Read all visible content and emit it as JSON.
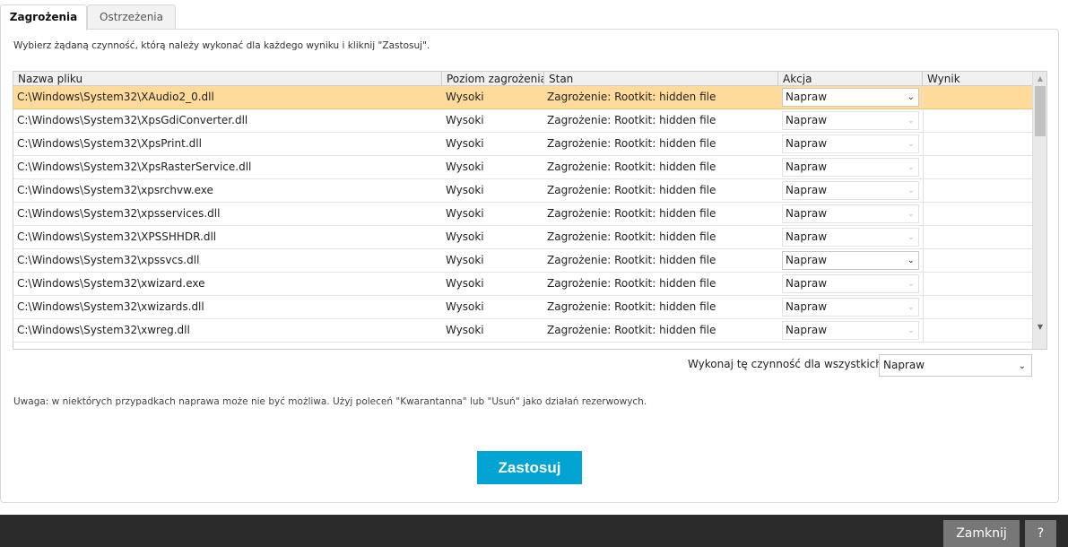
{
  "tabs": [
    {
      "label": "Zagrożenia",
      "active": true
    },
    {
      "label": "Ostrzeżenia",
      "active": false
    }
  ],
  "instruction": "Wybierz żądaną czynność, którą należy wykonać dla każdego wyniku i kliknij \"Zastosuj\".",
  "table": {
    "columns": [
      "Nazwa pliku",
      "Poziom zagrożenia",
      "Stan",
      "Akcja",
      "Wynik"
    ],
    "rows": [
      {
        "file": "C:\\Windows\\System32\\XAudio2_0.dll",
        "level": "Wysoki",
        "state": "Zagrożenie: Rootkit: hidden file",
        "action": "Napraw",
        "result": ""
      },
      {
        "file": "C:\\Windows\\System32\\XpsGdiConverter.dll",
        "level": "Wysoki",
        "state": "Zagrożenie: Rootkit: hidden file",
        "action": "Napraw",
        "result": ""
      },
      {
        "file": "C:\\Windows\\System32\\XpsPrint.dll",
        "level": "Wysoki",
        "state": "Zagrożenie: Rootkit: hidden file",
        "action": "Napraw",
        "result": ""
      },
      {
        "file": "C:\\Windows\\System32\\XpsRasterService.dll",
        "level": "Wysoki",
        "state": "Zagrożenie: Rootkit: hidden file",
        "action": "Napraw",
        "result": ""
      },
      {
        "file": "C:\\Windows\\System32\\xpsrchvw.exe",
        "level": "Wysoki",
        "state": "Zagrożenie: Rootkit: hidden file",
        "action": "Napraw",
        "result": ""
      },
      {
        "file": "C:\\Windows\\System32\\xpsservices.dll",
        "level": "Wysoki",
        "state": "Zagrożenie: Rootkit: hidden file",
        "action": "Napraw",
        "result": ""
      },
      {
        "file": "C:\\Windows\\System32\\XPSSHHDR.dll",
        "level": "Wysoki",
        "state": "Zagrożenie: Rootkit: hidden file",
        "action": "Napraw",
        "result": ""
      },
      {
        "file": "C:\\Windows\\System32\\xpssvcs.dll",
        "level": "Wysoki",
        "state": "Zagrożenie: Rootkit: hidden file",
        "action": "Napraw",
        "result": ""
      },
      {
        "file": "C:\\Windows\\System32\\xwizard.exe",
        "level": "Wysoki",
        "state": "Zagrożenie: Rootkit: hidden file",
        "action": "Napraw",
        "result": ""
      },
      {
        "file": "C:\\Windows\\System32\\xwizards.dll",
        "level": "Wysoki",
        "state": "Zagrożenie: Rootkit: hidden file",
        "action": "Napraw",
        "result": ""
      },
      {
        "file": "C:\\Windows\\System32\\xwreg.dll",
        "level": "Wysoki",
        "state": "Zagrożenie: Rootkit: hidden file",
        "action": "Napraw",
        "result": ""
      }
    ]
  },
  "apply_all": {
    "label": "Wykonaj tę czynność dla wszystkich:",
    "value": "Napraw"
  },
  "note": "Uwaga: w niektórych przypadkach naprawa może nie być możliwa. Użyj poleceń \"Kwarantanna\" lub \"Usuń\" jako działań rezerwowych.",
  "apply_button": "Zastosuj",
  "footer": {
    "close_label": "Zamknij",
    "help_label": "?"
  },
  "colors": {
    "accent": "#00a3d2",
    "selected_row": "#fedb9b",
    "footer_bg": "#2b2b2b",
    "footer_button": "#777777"
  },
  "icons": {
    "dropdown": "chevron-down-icon",
    "scroll_up": "scroll-up-arrow-icon",
    "scroll_down": "scroll-down-arrow-icon"
  }
}
